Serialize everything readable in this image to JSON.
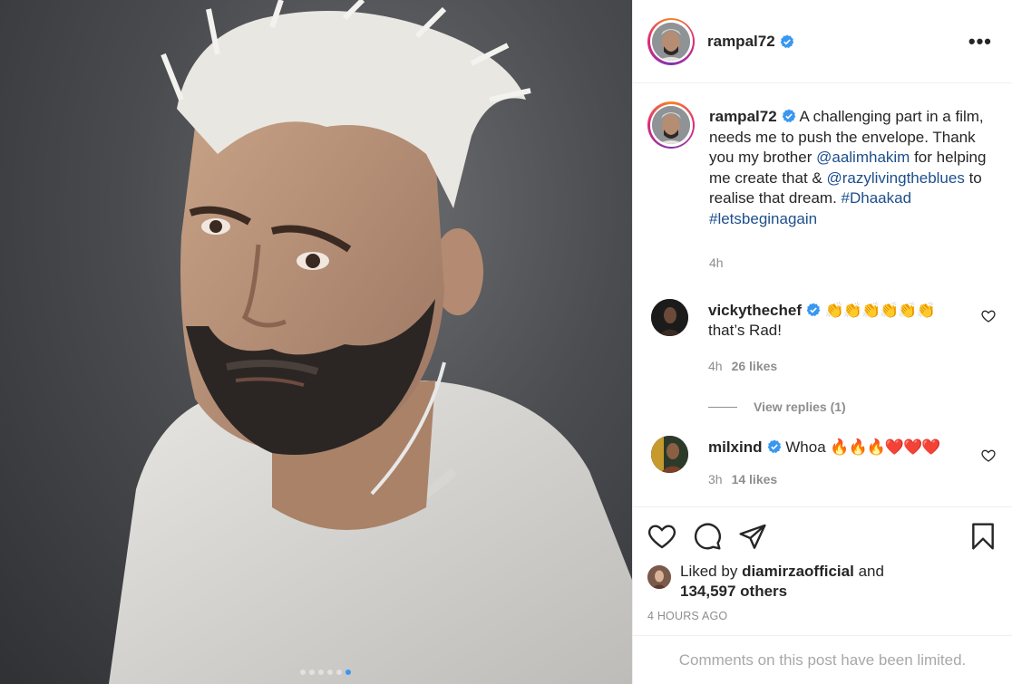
{
  "post": {
    "username": "rampal72",
    "caption": {
      "part1": "A challenging part in a film, needs me to push the envelope. Thank you my brother ",
      "mention1": "@aalimhakim",
      "part2": " for helping me create that & ",
      "mention2": "@razylivingtheblues",
      "part3": " to realise that dream. ",
      "hashtag1": "#Dhaakad",
      "hashtag2": "#letsbeginagain",
      "time": "4h"
    },
    "more_label": "•••"
  },
  "comments": [
    {
      "username": "vickythechef",
      "emoji": "👏👏👏👏👏👏",
      "text": "that’s Rad!",
      "time": "4h",
      "likes": "26 likes",
      "view_replies": "View replies (1)"
    },
    {
      "username": "milxind",
      "text": "Whoa",
      "emoji": "🔥🔥🔥❤️❤️❤️",
      "time": "3h",
      "likes": "14 likes"
    }
  ],
  "likes": {
    "prefix": "Liked by",
    "user": "diamirzaofficial",
    "and": "and",
    "others": "134,597 others"
  },
  "timestamp": "4 HOURS AGO",
  "comments_limited": "Comments on this post have been limited.",
  "carousel": {
    "count": 6,
    "active_index": 5
  },
  "colors": {
    "link": "#1e4f8c",
    "verified": "#3897f0",
    "muted": "#8e8e8e"
  },
  "icons": [
    "verified-icon",
    "more-options-icon",
    "heart-icon",
    "comment-icon",
    "share-icon",
    "bookmark-icon"
  ]
}
